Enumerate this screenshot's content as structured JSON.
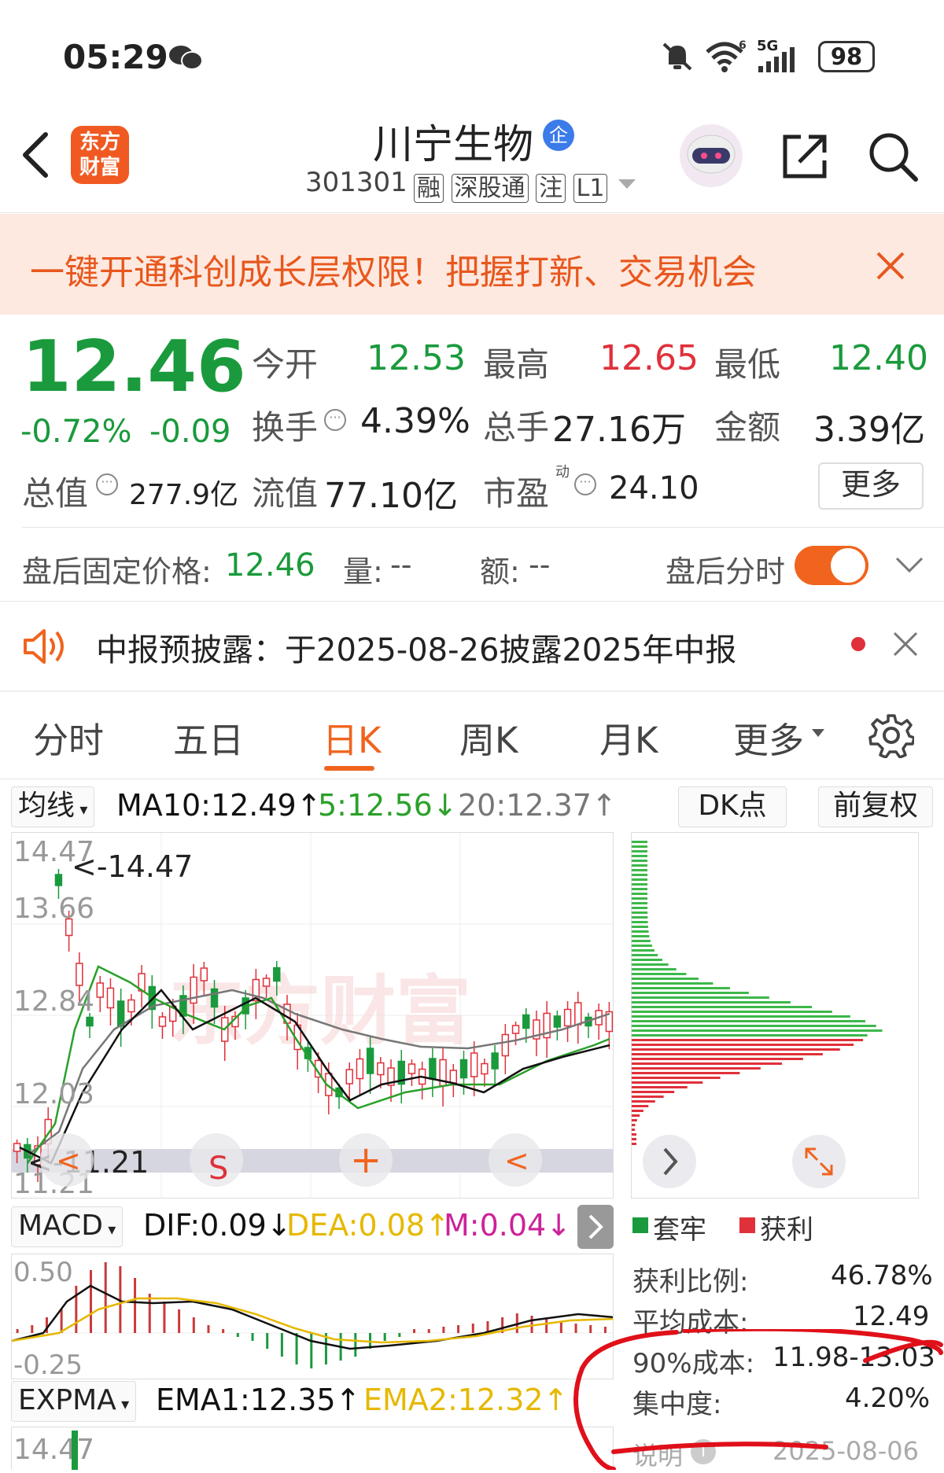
{
  "status_bar": {
    "time": "05:29",
    "battery": "98",
    "network": "5G"
  },
  "header": {
    "app_logo_text": "东方财富",
    "title": "川宁生物",
    "title_badge": "企",
    "code": "301301",
    "tags": [
      "融",
      "深股通",
      "注",
      "L1"
    ]
  },
  "banner": {
    "text": "一键开通科创成长层权限！把握打新、交易机会"
  },
  "quote": {
    "price": "12.46",
    "change_pct": "-0.72%",
    "change_abs": "-0.09",
    "open_label": "今开",
    "open": "12.53",
    "high_label": "最高",
    "high": "12.65",
    "low_label": "最低",
    "low": "12.40",
    "turnover_label": "换手",
    "turnover": "4.39%",
    "volume_label": "总手",
    "volume": "27.16万",
    "amount_label": "金额",
    "amount": "3.39亿",
    "mktcap_label": "总值",
    "mktcap": "277.9亿",
    "float_label": "流值",
    "float": "77.10亿",
    "pe_label": "市盈",
    "pe_sup": "动",
    "pe": "24.10",
    "more_label": "更多"
  },
  "after_hours": {
    "price_label": "盘后固定价格:",
    "price": "12.46",
    "vol_label": "量:",
    "vol": "--",
    "amt_label": "额:",
    "amt": "--",
    "toggle_label": "盘后分时",
    "toggle_on": true
  },
  "notice": {
    "text": "中报预披露：于2025-08-26披露2025年中报"
  },
  "tabs": [
    "分时",
    "五日",
    "日K",
    "周K",
    "月K",
    "更多"
  ],
  "active_tab": "日K",
  "ma_bar": {
    "selector": "均线",
    "ma10": "MA10:12.49↑",
    "ma5": "5:12.56↓",
    "ma20": "20:12.37↑",
    "dk_label": "DK点",
    "adjust_label": "前复权"
  },
  "kline": {
    "y_ticks": [
      "14.47",
      "13.66",
      "12.84",
      "12.03",
      "11.21"
    ],
    "max_marker": "<-14.47",
    "min_marker": "<-11.21",
    "watermark": "东方财富",
    "overlay_buttons": [
      "<",
      "S",
      "+",
      "<"
    ]
  },
  "macd": {
    "selector": "MACD",
    "dif": "DIF:0.09↓",
    "dea": "DEA:0.08↑",
    "m": "M:0.04↓",
    "y_ticks": [
      "0.50",
      "-0.25"
    ]
  },
  "expma": {
    "selector": "EXPMA",
    "ema1": "EMA1:12.35↑",
    "ema2": "EMA2:12.32↑",
    "y_tick": "14.47"
  },
  "chip": {
    "legend_trapped": "套牢",
    "legend_profit": "获利",
    "profit_ratio_label": "获利比例:",
    "profit_ratio": "46.78%",
    "avg_cost_label": "平均成本:",
    "avg_cost": "12.49",
    "cost90_label": "90%成本:",
    "cost90": "11.98-13.03",
    "concentration_label": "集中度:",
    "concentration": "4.20%",
    "note_label": "说明",
    "date": "2025-08-06"
  },
  "colors": {
    "up": "#e0303a",
    "down": "#1a9a3c",
    "accent": "#f0641e",
    "ma5": "#111111",
    "ma10": "#2aa02a",
    "ma20": "#777777",
    "dea": "#e6b800",
    "m": "#cc2299"
  }
}
